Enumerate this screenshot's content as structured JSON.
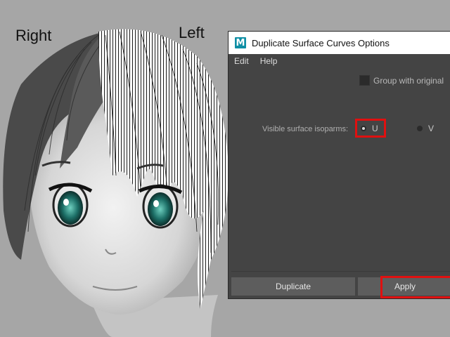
{
  "viewport": {
    "label_right": "Right",
    "label_left": "Left"
  },
  "dialog": {
    "title": "Duplicate Surface Curves Options",
    "app_icon_letter": "M",
    "menu": [
      "Edit",
      "Help"
    ],
    "group_with_original_label": "Group with original",
    "visible_isoparms_label": "Visible surface isoparms:",
    "radio_u_label": "U",
    "radio_v_label": "V",
    "selected_isoparm": "U",
    "buttons": {
      "duplicate": "Duplicate",
      "apply": "Apply"
    },
    "highlight_color": "#e01010",
    "icon_color": "#0f8fa5"
  }
}
